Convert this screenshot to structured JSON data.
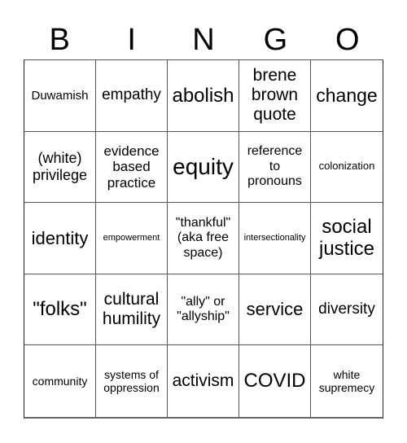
{
  "header": {
    "letters": [
      "B",
      "I",
      "N",
      "G",
      "O"
    ]
  },
  "board": {
    "rows": [
      [
        "Duwamish",
        "empathy",
        "abolish",
        "brene brown quote",
        "change"
      ],
      [
        "(white) privilege",
        "evidence based practice",
        "equity",
        "reference to pronouns",
        "colonization"
      ],
      [
        "identity",
        "empowerment",
        "\"thankful\" (aka free space)",
        "intersectionality",
        "social justice"
      ],
      [
        "\"folks\"",
        "cultural humility",
        "\"ally\" or \"allyship\"",
        "service",
        "diversity"
      ],
      [
        "community",
        "systems of oppression",
        "activism",
        "COVID",
        "white supremecy"
      ]
    ]
  }
}
